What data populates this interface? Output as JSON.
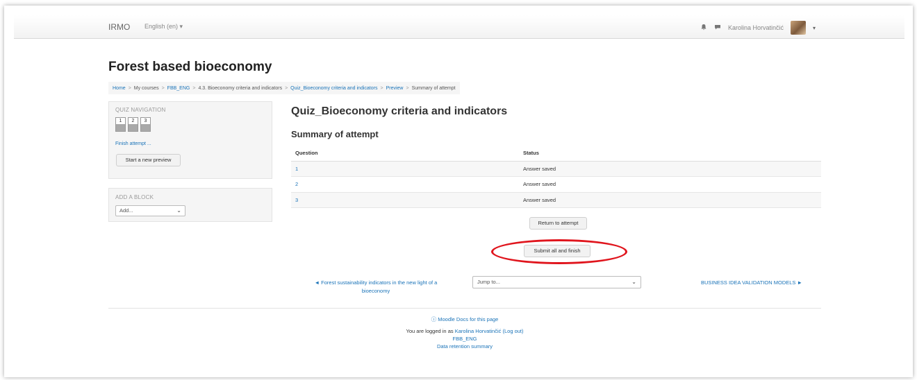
{
  "navbar": {
    "brand": "IRMO",
    "language": "English (en) ▾",
    "notification_icon": "bell-icon",
    "messages_icon": "chat-bubble-icon",
    "username": "Karolina Horvatinčić",
    "caret": "▾"
  },
  "page": {
    "title": "Forest based bioeconomy"
  },
  "breadcrumb": [
    {
      "label": "Home",
      "link": true
    },
    {
      "label": "My courses",
      "link": false
    },
    {
      "label": "FBB_ENG",
      "link": true
    },
    {
      "label": "4.3. Bioeconomy criteria and indicators",
      "link": false
    },
    {
      "label": "Quiz_Bioeconomy criteria and indicators",
      "link": true
    },
    {
      "label": "Preview",
      "link": true
    },
    {
      "label": "Summary of attempt",
      "link": false
    }
  ],
  "breadcrumb_separator": ">",
  "quiz_navigation": {
    "title": "QUIZ NAVIGATION",
    "buttons": [
      "1",
      "2",
      "3"
    ],
    "finish_link": "Finish attempt ...",
    "preview_button": "Start a new preview"
  },
  "add_block": {
    "title": "ADD A BLOCK",
    "select_value": "Add..."
  },
  "main": {
    "quiz_title": "Quiz_Bioeconomy criteria and indicators",
    "summary_title": "Summary of attempt",
    "table": {
      "headers": [
        "Question",
        "Status"
      ],
      "rows": [
        {
          "question": "1",
          "status": "Answer saved"
        },
        {
          "question": "2",
          "status": "Answer saved"
        },
        {
          "question": "3",
          "status": "Answer saved"
        }
      ]
    },
    "return_button": "Return to attempt",
    "submit_button": "Submit all and finish",
    "highlight_color": "#e0151d"
  },
  "activity_nav": {
    "prev_link": "◄ Forest sustainability indicators in the new light of a bioeconomy",
    "jump_select": "Jump to...",
    "next_link": "BUSINESS IDEA VALIDATION MODELS ►"
  },
  "footer": {
    "docs_link": "ⓘ Moodle Docs for this page",
    "logged_in_text": "You are logged in as ",
    "logged_in_user": "Karolina Horvatinčić (Log out)",
    "course_link": "FBB_ENG",
    "data_retention": "Data retention summary"
  },
  "colors": {
    "link": "#1a73b8",
    "block_bg": "#f5f5f5"
  }
}
